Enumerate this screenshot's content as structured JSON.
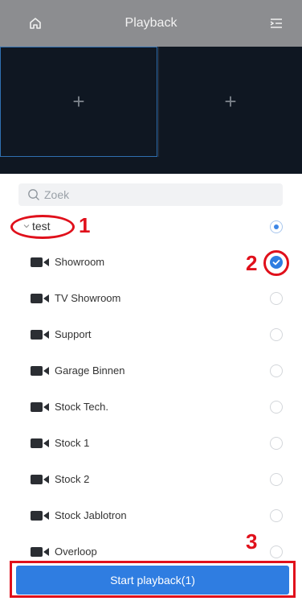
{
  "header": {
    "title": "Playback",
    "home_icon": "home-icon",
    "menu_icon": "menu-collapse-icon"
  },
  "grid": {
    "cells": [
      {
        "icon": "plus-icon"
      },
      {
        "icon": "plus-icon"
      }
    ]
  },
  "search": {
    "placeholder": "Zoek"
  },
  "group": {
    "label": "test",
    "selected": true
  },
  "cameras": [
    {
      "label": "Showroom",
      "checked": true
    },
    {
      "label": "TV Showroom",
      "checked": false
    },
    {
      "label": "Support",
      "checked": false
    },
    {
      "label": "Garage Binnen",
      "checked": false
    },
    {
      "label": "Stock Tech.",
      "checked": false
    },
    {
      "label": "Stock 1",
      "checked": false
    },
    {
      "label": "Stock 2",
      "checked": false
    },
    {
      "label": "Stock Jablotron",
      "checked": false
    },
    {
      "label": "Overloop",
      "checked": false
    }
  ],
  "annotations": {
    "step1": "1",
    "step2": "2",
    "step3": "3"
  },
  "start_button": {
    "label": "Start playback(1)"
  },
  "colors": {
    "accent": "#2f7de1",
    "annotation": "#e0101b",
    "header": "#8c8d90",
    "grid_bg": "#0f1722"
  }
}
